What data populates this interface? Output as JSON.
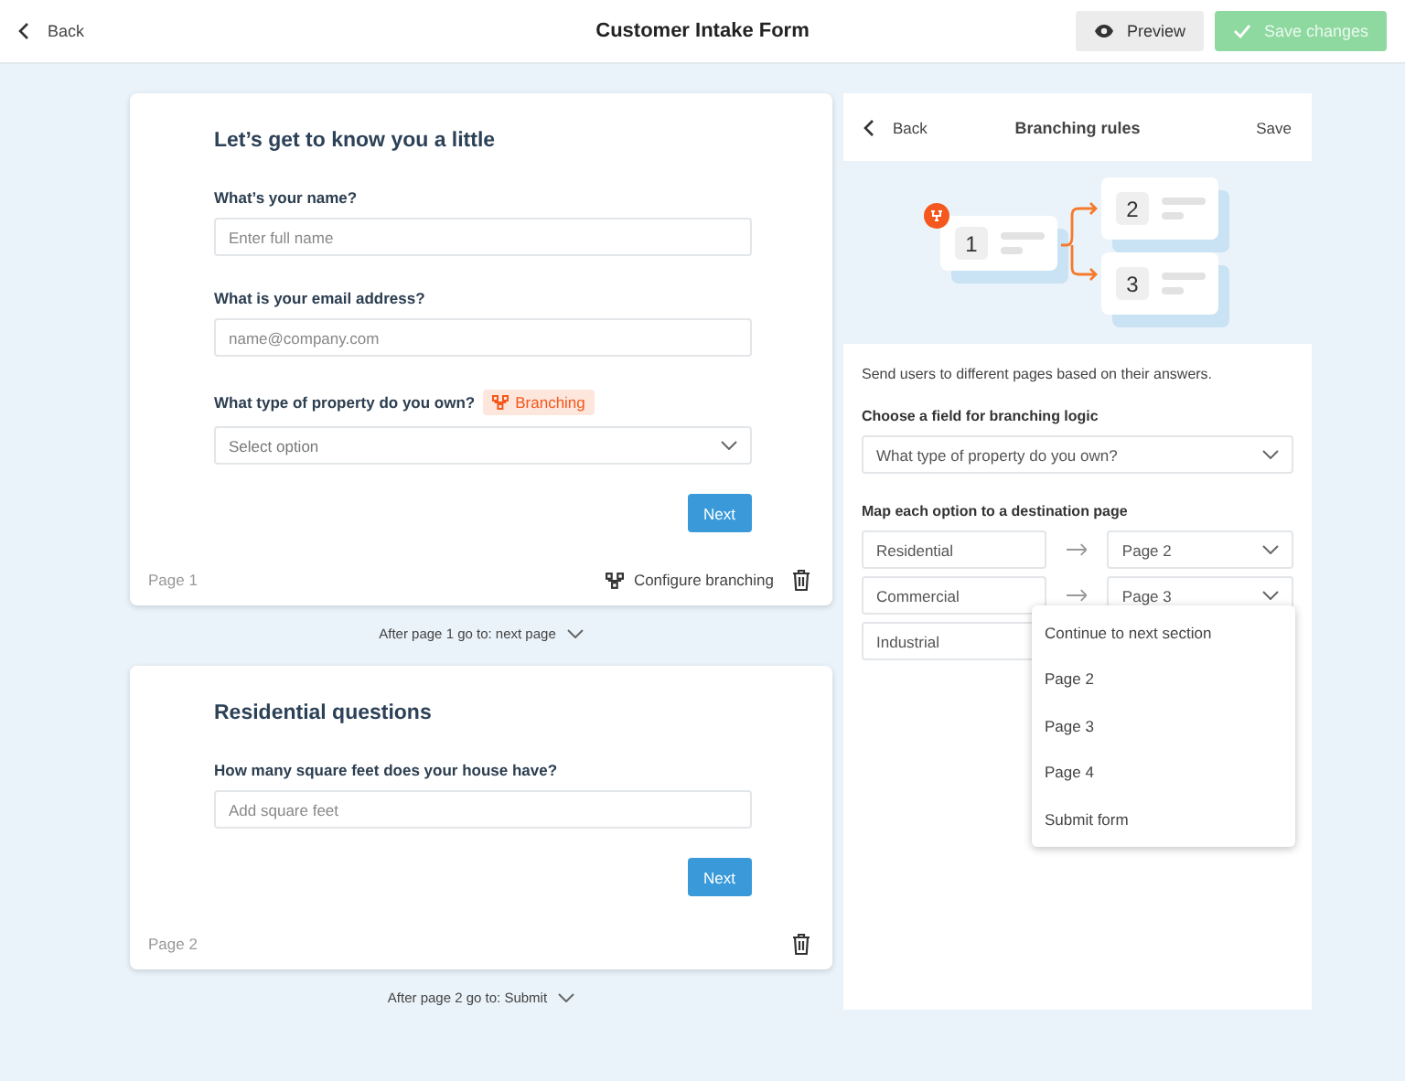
{
  "header": {
    "back": "Back",
    "title": "Customer Intake Form",
    "preview": "Preview",
    "save": {
      "label": "Save changes",
      "disabled": true
    }
  },
  "pages": [
    {
      "title": "Let’s get to know you a little",
      "fields": [
        {
          "kind": "text",
          "label": "What’s your name?",
          "placeholder": "Enter full name"
        },
        {
          "kind": "text",
          "label": "What is your email address?",
          "placeholder": "name@company.com"
        },
        {
          "kind": "select",
          "label": "What type of property do you own?",
          "badge": "Branching",
          "placeholder": "Select option"
        }
      ],
      "next": "Next",
      "footer_label": "Page 1",
      "configure": "Configure branching",
      "after": "After page 1 go to: next page"
    },
    {
      "title": "Residential questions",
      "fields": [
        {
          "kind": "text",
          "label": "How many square feet does your house have?",
          "placeholder": "Add square feet"
        }
      ],
      "next": "Next",
      "footer_label": "Page 2",
      "after": "After page 2 go to: Submit"
    }
  ],
  "panel": {
    "back": "Back",
    "title": "Branching rules",
    "save": "Save",
    "diagram_numbers": [
      "1",
      "2",
      "3"
    ],
    "description": "Send users to different pages based on their answers.",
    "field_label": "Choose a field for branching logic",
    "field_value": "What type of property do you own?",
    "map_label": "Map each option to a destination page",
    "mappings": [
      {
        "option": "Residential",
        "destination": "Page 2"
      },
      {
        "option": "Commercial",
        "destination": "Page 3"
      },
      {
        "option": "Industrial"
      }
    ],
    "menu": [
      {
        "label": "Continue to next section"
      },
      {
        "label": "Page 2"
      },
      {
        "label": "Page 3"
      },
      {
        "label": "Page 4"
      },
      {
        "label": "Submit form"
      }
    ]
  }
}
